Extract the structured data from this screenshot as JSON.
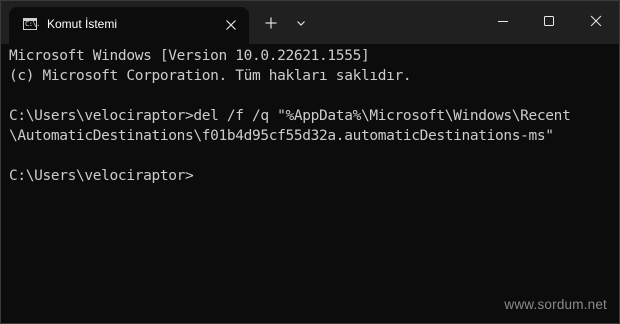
{
  "window": {
    "tab_title": "Komut İstemi",
    "tab_icon": "cmd-terminal-icon",
    "tab_icon_glyph": "C:\\."
  },
  "titlebar": {
    "new_tab_icon": "plus-icon",
    "dropdown_icon": "chevron-down-icon",
    "minimize_icon": "minimize-icon",
    "maximize_icon": "maximize-icon",
    "close_icon": "close-icon"
  },
  "console": {
    "lines": [
      "Microsoft Windows [Version 10.0.22621.1555]",
      "(c) Microsoft Corporation. Tüm hakları saklıdır.",
      "",
      "C:\\Users\\velociraptor>del /f /q \"%AppData%\\Microsoft\\Windows\\Recent",
      "\\AutomaticDestinations\\f01b4d95cf55d32a.automaticDestinations-ms\"",
      "",
      "C:\\Users\\velociraptor>"
    ]
  },
  "watermark": "www.sordum.net",
  "colors": {
    "titlebar_bg": "#202020",
    "console_bg": "#0c0c0c",
    "console_text": "#cccccc"
  }
}
